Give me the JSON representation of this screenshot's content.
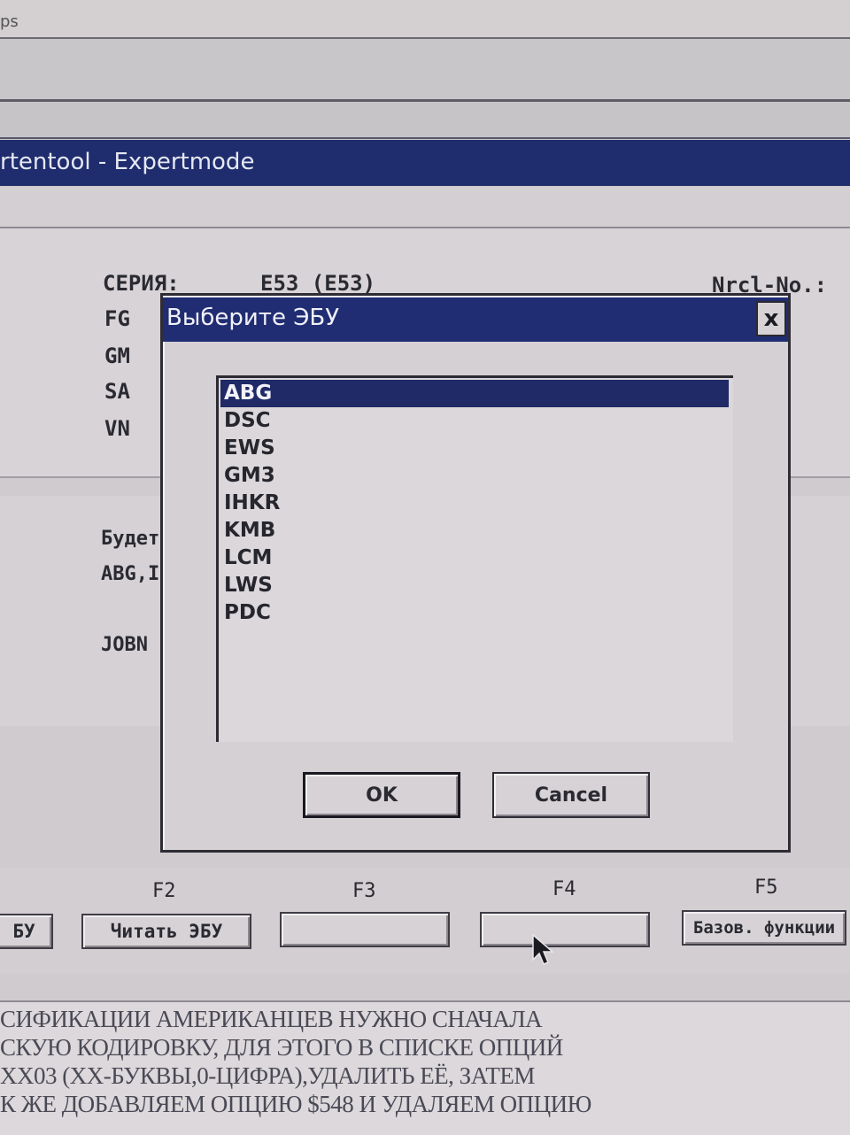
{
  "background": {
    "top_window_fragment": "ps",
    "main_window_title": "rtentool - Expertmode"
  },
  "vehicle_info": {
    "series_label": "СЕРИЯ:",
    "series_value": "E53 (E53)",
    "nrcl_label": "Nrcl-No.:",
    "fields": [
      "FG",
      "GM",
      "SA",
      "VN"
    ]
  },
  "mid_panel": {
    "line1": "Будет",
    "line2": "ABG,I",
    "line3": "JOBN"
  },
  "dialog": {
    "title": "Выберите ЭБУ",
    "close_label": "x",
    "ecu_list": [
      "ABG",
      "DSC",
      "EWS",
      "GM3",
      "IHKR",
      "KMB",
      "LCM",
      "LWS",
      "PDC"
    ],
    "selected_index": 0,
    "ok_label": "OK",
    "cancel_label": "Cancel"
  },
  "function_keys": {
    "f1_button": "БУ",
    "f2_label": "F2",
    "f2_button": "Читать ЭБУ",
    "f3_label": "F3",
    "f3_button": "",
    "f4_label": "F4",
    "f4_button": "",
    "f5_label": "F5",
    "f5_button": "Базов. функции"
  },
  "log_text": [
    "СИФИКАЦИИ АМЕРИКАНЦЕВ НУЖНО СНАЧАЛА",
    "СКУЮ КОДИРОВКУ, ДЛЯ ЭТОГО В СПИСКЕ ОПЦИЙ",
    "XX03 (XX-БУКВЫ,0-ЦИФРА),УДАЛИТЬ ЕЁ, ЗАТЕМ",
    "К ЖЕ ДОБАВЛЯЕМ ОПЦИЮ $548 И УДАЛЯЕМ ОПЦИЮ"
  ],
  "colors": {
    "titlebar": "#1f2d6e",
    "selection": "#1f2a66",
    "face": "#d4d0d3"
  }
}
